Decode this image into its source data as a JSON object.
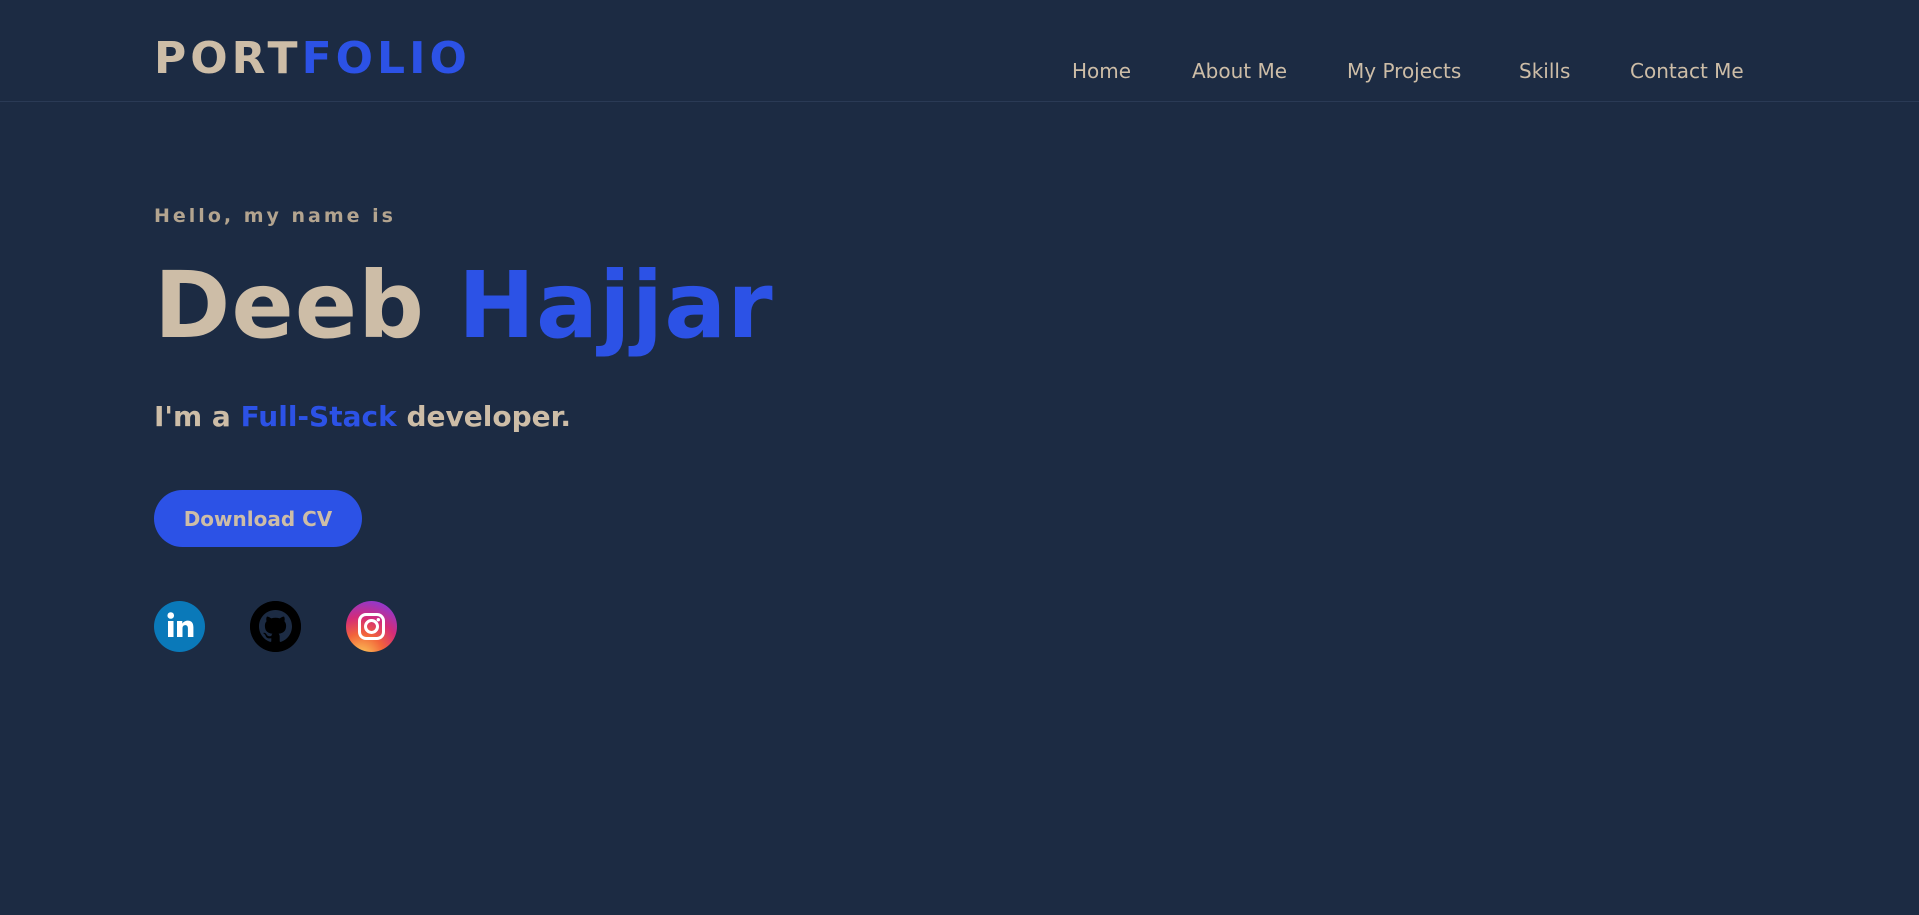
{
  "header": {
    "logo": {
      "part_a": "PORT",
      "part_b": "FOLIO"
    },
    "nav": [
      {
        "label": "Home"
      },
      {
        "label": "About Me"
      },
      {
        "label": "My Projects"
      },
      {
        "label": "Skills"
      },
      {
        "label": "Contact Me"
      }
    ]
  },
  "hero": {
    "greeting": "Hello, my name is",
    "first_name": "Deeb",
    "last_name": "Hajjar",
    "role_prefix": "I'm a",
    "role_highlight": "Full-Stack",
    "role_suffix": "developer.",
    "cv_button_label": "Download CV"
  },
  "socials": [
    {
      "name": "linkedin",
      "icon": "linkedin-icon"
    },
    {
      "name": "github",
      "icon": "github-icon"
    },
    {
      "name": "instagram",
      "icon": "instagram-icon"
    }
  ],
  "colors": {
    "background": "#1c2b43",
    "accent": "#2c52e6",
    "text_beige": "#cdbda7",
    "greeting_text": "#b3a48f"
  }
}
